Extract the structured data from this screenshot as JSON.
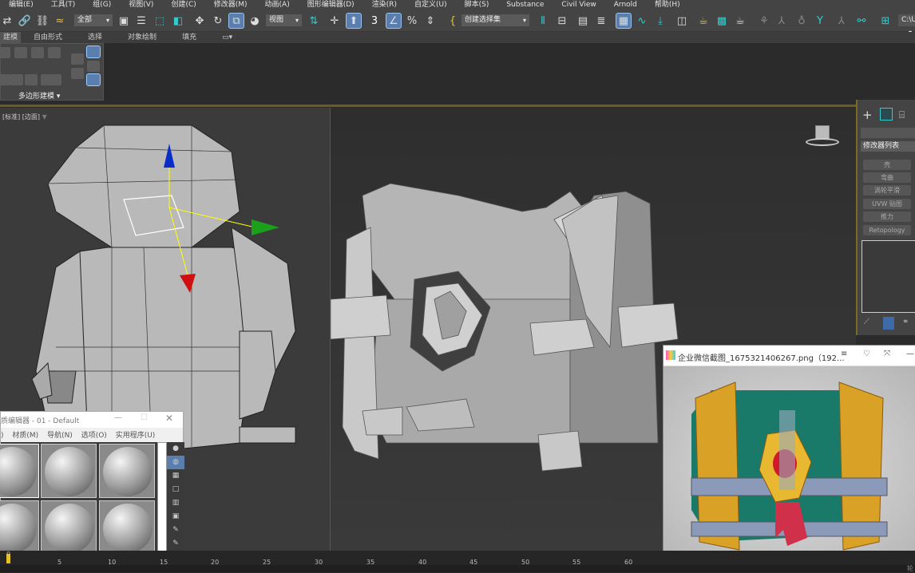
{
  "menu": [
    "编辑(E)",
    "工具(T)",
    "组(G)",
    "视图(V)",
    "创建(C)",
    "修改器(M)",
    "动画(A)",
    "图形编辑器(D)",
    "渲染(R)",
    "自定义(U)",
    "脚本(S)",
    "Substance",
    "Civil View",
    "Arnold",
    "帮助(H)"
  ],
  "toolbar": {
    "selection_filter": "全部",
    "reference_coord": "视图",
    "named_selection": "创建选择集",
    "path": "C:\\U"
  },
  "ribbon_tabs": [
    "建模",
    "自由形式",
    "选择",
    "对象绘制",
    "填充"
  ],
  "ribbon": {
    "panel_label": "多边形建模"
  },
  "viewport_left": {
    "label": "[标准] [边面]"
  },
  "command_panel": {
    "modifier_list": "修改器列表",
    "buttons": [
      "壳",
      "弯曲",
      "涡轮平滑",
      "UVW 贴图",
      "推力",
      "Retopology"
    ]
  },
  "material_editor": {
    "title": "质编辑器 - 01 - Default",
    "menu": [
      "材质(M)",
      "导航(N)",
      "选项(O)",
      "实用程序(U)"
    ]
  },
  "image_viewer": {
    "title": "企业微信截图_1675321406267.png（192..."
  },
  "timeline": {
    "ticks": [
      "0",
      "5",
      "10",
      "15",
      "20",
      "25",
      "30",
      "35",
      "40",
      "45",
      "50",
      "55",
      "60"
    ]
  },
  "status": {
    "right": "轮"
  }
}
